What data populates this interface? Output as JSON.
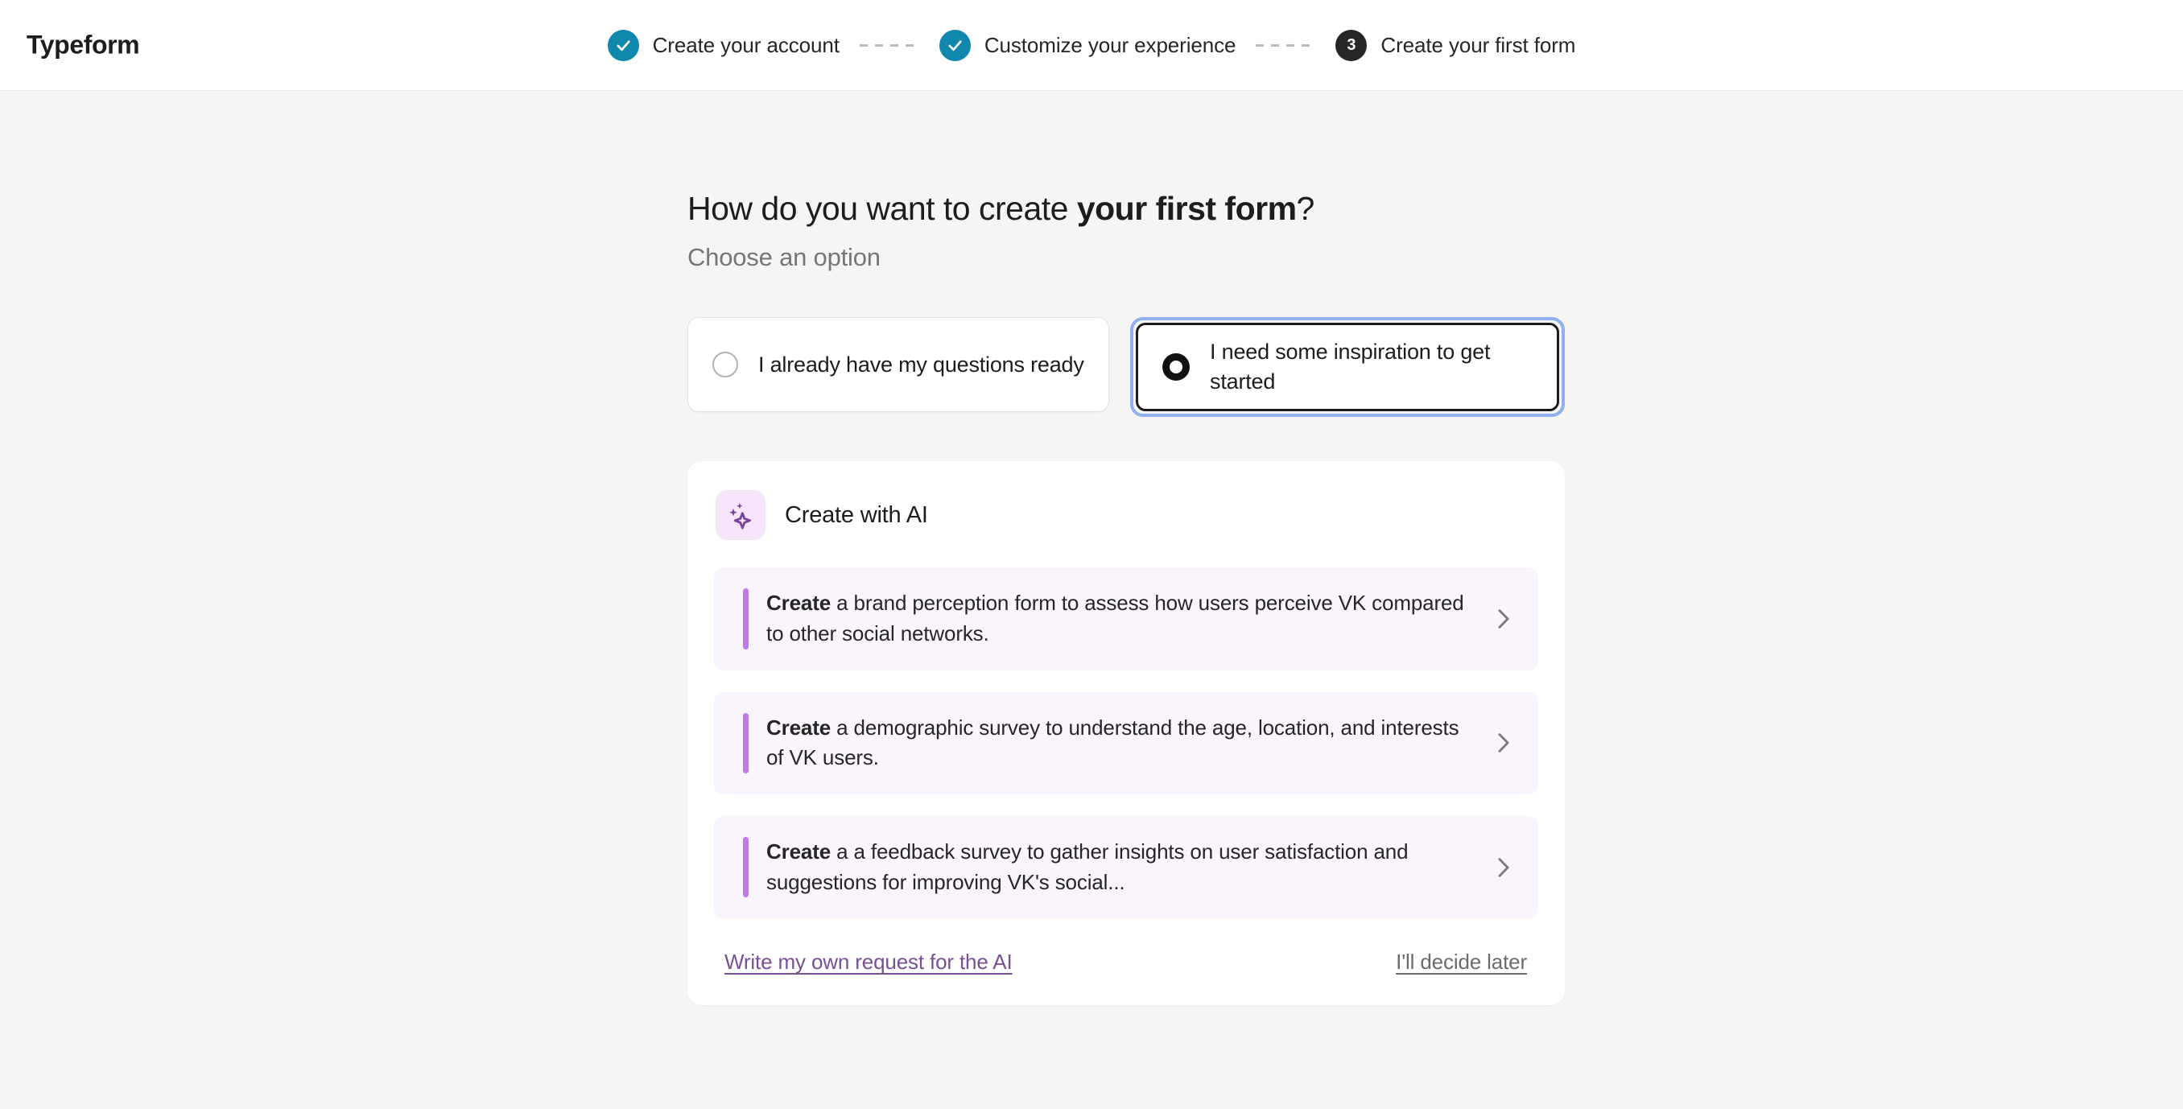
{
  "header": {
    "brand": "Typeform",
    "steps": [
      {
        "label": "Create your account",
        "state": "done",
        "marker": "check-icon"
      },
      {
        "label": "Customize your experience",
        "state": "done",
        "marker": "check-icon"
      },
      {
        "label": "Create your first form",
        "state": "current",
        "marker": "3"
      }
    ]
  },
  "main": {
    "title_prefix": "How do you want to create ",
    "title_bold": "your first form",
    "title_suffix": "?",
    "subtitle": "Choose an option",
    "options": [
      {
        "label": "I already have my questions ready",
        "selected": false
      },
      {
        "label": "I need some inspiration to get started",
        "selected": true
      }
    ],
    "ai": {
      "icon": "sparkles-icon",
      "title": "Create with AI",
      "suggestions": [
        {
          "bold": "Create",
          "text": " a brand perception form to assess how users perceive VK compared to other social networks.",
          "chevron": "chevron-right-icon"
        },
        {
          "bold": "Create",
          "text": " a demographic survey to understand the age, location, and interests of VK users.",
          "chevron": "chevron-right-icon"
        },
        {
          "bold": "Create",
          "text": " a a feedback survey to gather insights on user satisfaction and suggestions for improving VK's social...",
          "chevron": "chevron-right-icon"
        }
      ],
      "write_own_link": "Write my own request for the AI",
      "decide_later_link": "I'll decide later"
    }
  },
  "colors": {
    "step_done": "#1087ac",
    "step_current": "#262626",
    "page_bg": "#f5f5f4",
    "focus_ring": "#92b0ee",
    "accent_purple": "#c077ef",
    "link_purple": "#7a4f96",
    "suggestion_bg": "#faf5fd"
  }
}
